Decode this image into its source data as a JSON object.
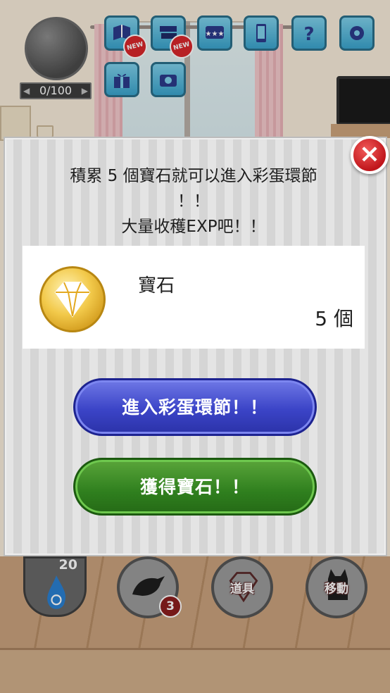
{
  "hud": {
    "progress_text": "0/100",
    "new_badge": "NEW",
    "buttons": [
      {
        "icon": "book-icon",
        "new": true
      },
      {
        "icon": "book-stack-icon",
        "new": true
      },
      {
        "icon": "rating-stars-icon",
        "new": false
      },
      {
        "icon": "phone-icon",
        "new": false
      },
      {
        "icon": "help-question-icon",
        "new": false
      },
      {
        "icon": "gear-icon",
        "new": false
      },
      {
        "icon": "gift-icon",
        "new": false
      },
      {
        "icon": "camera-icon",
        "new": false
      }
    ]
  },
  "dialog": {
    "message_line1": "積累 5 個寶石就可以進入彩蛋環節",
    "message_line2": "！！",
    "message_line3": "大量收穫EXP吧！！",
    "item_name": "寶石",
    "item_count": "5 個",
    "enter_button": "進入彩蛋環節！！",
    "get_button": "獲得寶石！！",
    "close_symbol": "×"
  },
  "bottom": {
    "energy_value": "20",
    "crow_count": "3",
    "items_label": "道具",
    "move_label": "移動"
  },
  "colors": {
    "accent_blue": "#3b44c7",
    "accent_green": "#2f7f1e",
    "close_red": "#d8262b"
  }
}
